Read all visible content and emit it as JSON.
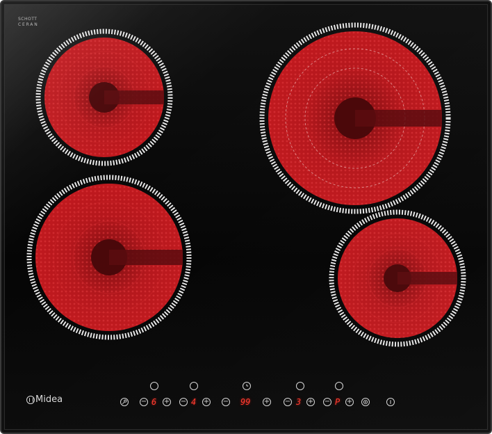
{
  "logo": {
    "line1": "SCHOTT",
    "line2": "CERAN"
  },
  "brand": {
    "name": "Midea"
  },
  "controls": {
    "zone_displays": [
      {
        "value": "6"
      },
      {
        "value": "4"
      },
      {
        "value": "3"
      },
      {
        "value": "P"
      }
    ],
    "timer_display": "99",
    "minus_symbol": "−",
    "plus_symbol": "+"
  },
  "colors": {
    "glass": "#0a0a0a",
    "zone_red": "#b5171c",
    "zone_dark": "#5a0b0e",
    "display_red": "#ff3b2f",
    "control_outline": "#d8d8d8"
  }
}
